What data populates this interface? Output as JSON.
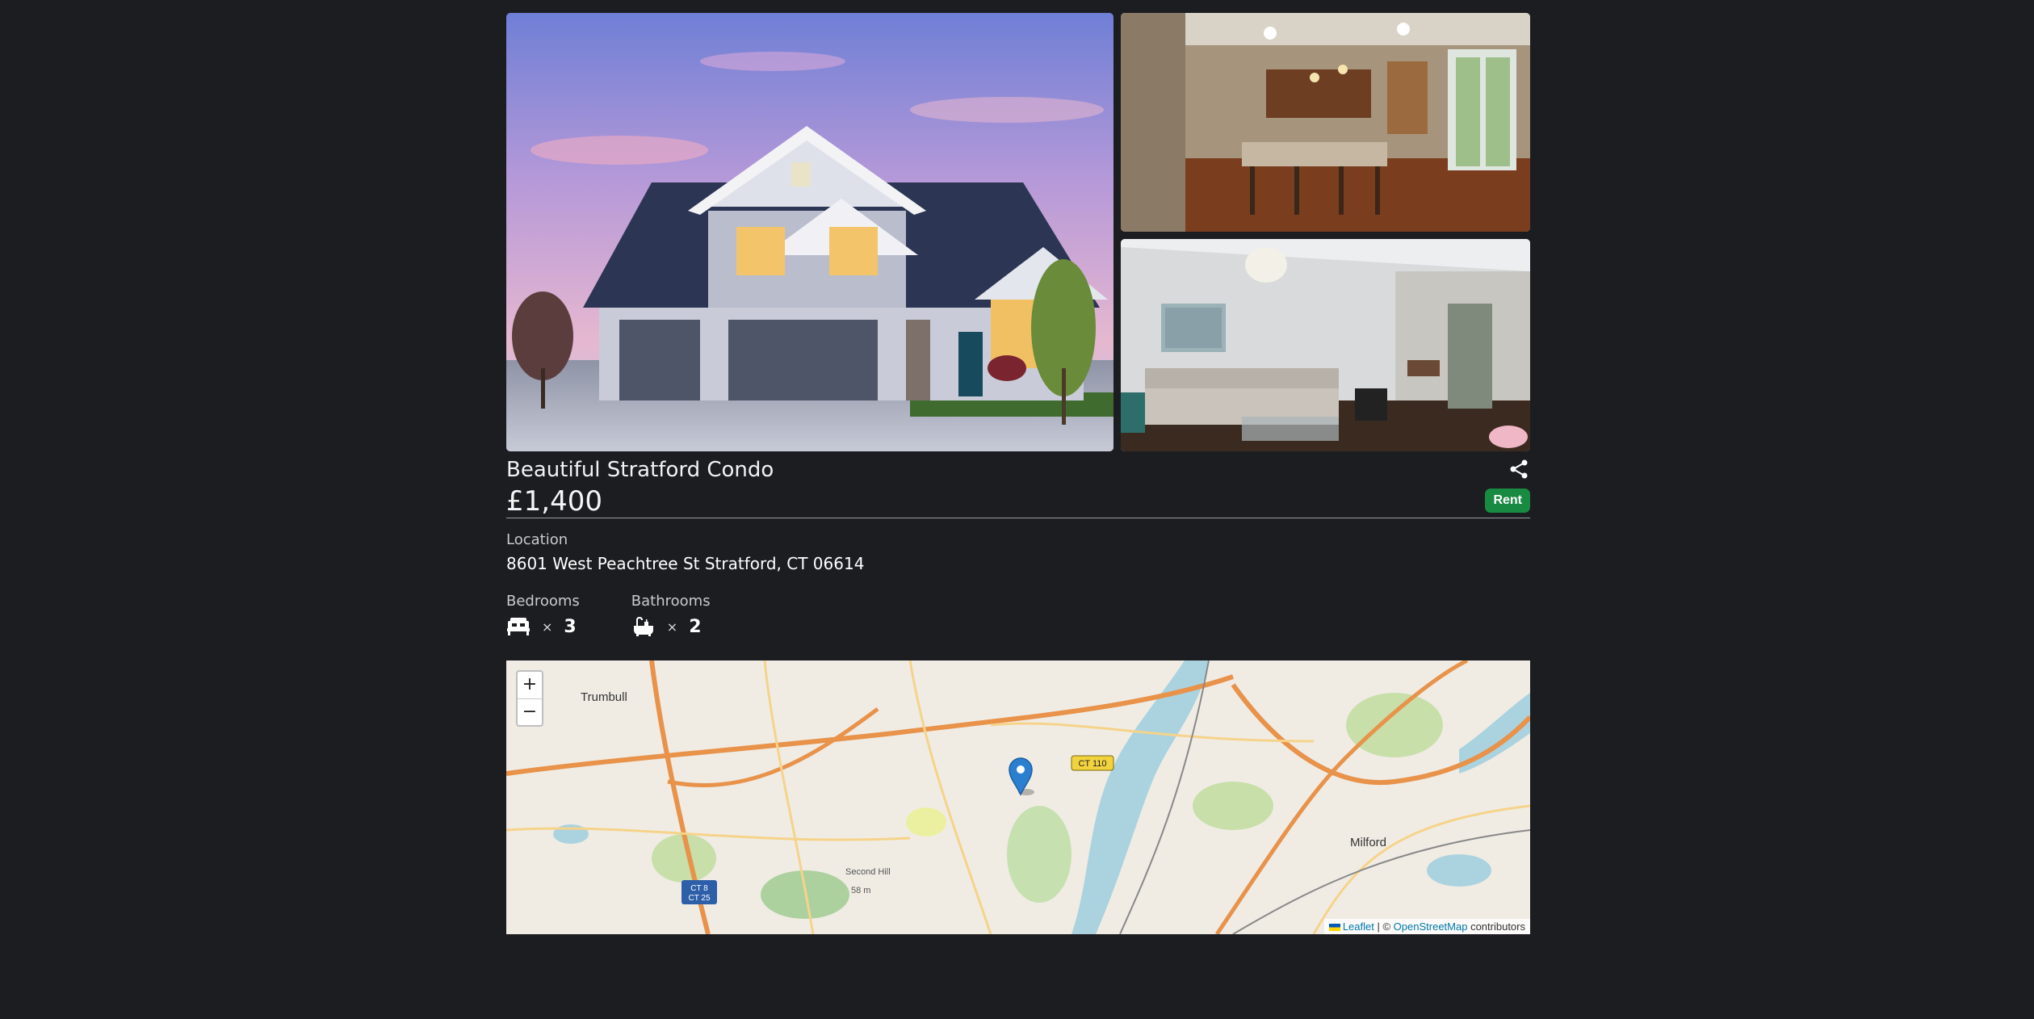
{
  "listing": {
    "title": "Beautiful Stratford Condo",
    "price": "£1,400",
    "badge": "Rent",
    "location_label": "Location",
    "address": "8601 West Peachtree St Stratford, CT 06614"
  },
  "rooms": {
    "bedrooms_label": "Bedrooms",
    "bedrooms_times": "×",
    "bedrooms_count": "3",
    "bathrooms_label": "Bathrooms",
    "bathrooms_times": "×",
    "bathrooms_count": "2"
  },
  "map": {
    "zoom_in": "+",
    "zoom_out": "−",
    "attribution_leaflet": "Leaflet",
    "attribution_sep": " | © ",
    "attribution_osm": "OpenStreetMap",
    "attribution_tail": " contributors",
    "labels": {
      "trumbull": "Trumbull",
      "milford": "Milford",
      "ct110": "CT 110",
      "ct8": "CT 8",
      "ct25": "CT 25",
      "second_hill": "Second Hill",
      "elev": "58 m"
    }
  },
  "colors": {
    "background": "#1c1d21",
    "badge": "#198a42",
    "marker": "#2a7fd0"
  },
  "icons": {
    "share": "share-icon",
    "bed": "bed-icon",
    "bath": "bath-icon",
    "marker": "map-marker-icon"
  }
}
